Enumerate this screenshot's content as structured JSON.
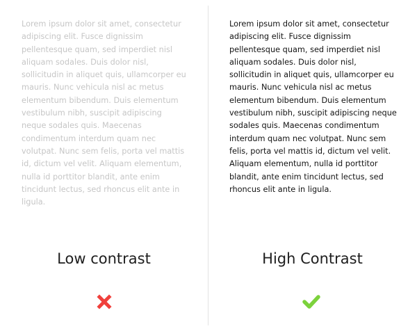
{
  "low": {
    "paragraph": "Lorem ipsum dolor sit amet, consectetur adipiscing elit. Fusce dignissim pellentesque quam, sed imperdiet nisl aliquam sodales. Duis dolor nisl, sollicitudin in aliquet quis, ullamcorper eu mauris. Nunc vehicula nisl ac metus elementum bibendum. Duis elementum vestibulum nibh, suscipit adipiscing neque sodales quis. Maecenas condimentum interdum quam nec volutpat. Nunc sem felis, porta vel mattis id, dictum vel velit. Aliquam elementum, nulla id porttitor blandit, ante enim tincidunt lectus, sed rhoncus elit ante in ligula.",
    "label": "Low contrast",
    "text_color": "#c6c6c6",
    "icon": "cross-icon",
    "icon_color": "#f0403c"
  },
  "high": {
    "paragraph": "Lorem ipsum dolor sit amet, consectetur adipiscing elit. Fusce dignissim pellentesque quam, sed imperdiet nisl aliquam sodales. Duis dolor nisl, sollicitudin in aliquet quis, ullamcorper eu mauris. Nunc vehicula nisl ac metus elementum bibendum. Duis elementum vestibulum nibh, suscipit adipiscing neque sodales quis. Maecenas condimentum interdum quam nec volutpat. Nunc sem felis, porta vel mattis id, dictum vel velit. Aliquam elementum, nulla id porttitor blandit, ante enim tincidunt lectus, sed rhoncus elit ante in ligula.",
    "label": "High Contrast",
    "text_color": "#141414",
    "icon": "checkmark-icon",
    "icon_color": "#7cd23c"
  }
}
